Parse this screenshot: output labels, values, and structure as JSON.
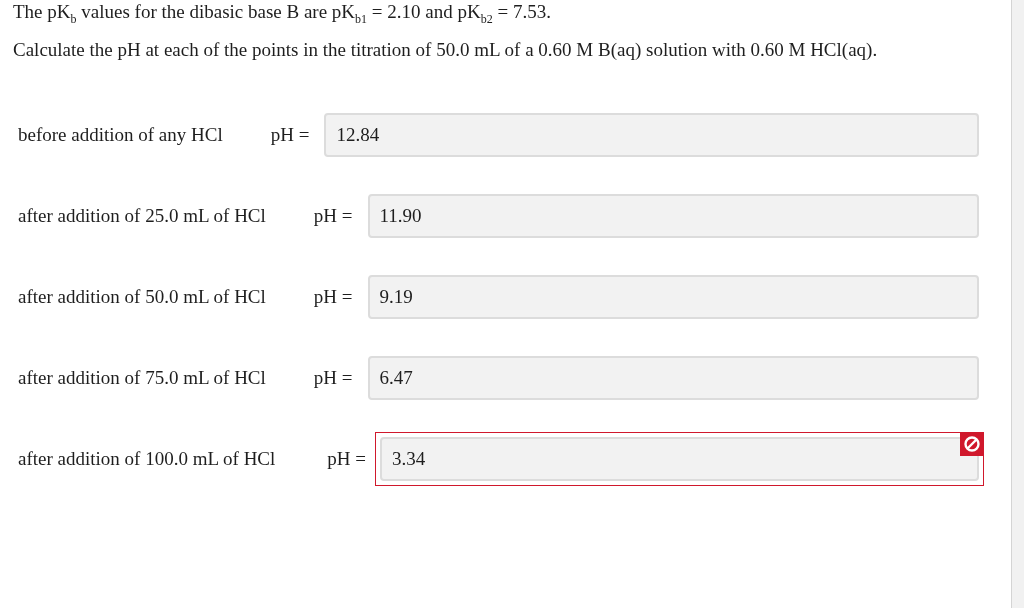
{
  "question": {
    "intro": "The pK$_{b}$ values for the dibasic base B are pK$_{b1}$ = 2.10 and pK$_{b2}$ = 7.53.",
    "instruction": "Calculate the pH at each of the points in the titration of 50.0 mL of a 0.60 M B(aq) solution with 0.60 M HCl(aq)."
  },
  "answers": [
    {
      "label": "before addition of any HCl",
      "prefix": "pH =",
      "value": "12.84",
      "incorrect": false
    },
    {
      "label": "after addition of 25.0 mL of HCl",
      "prefix": "pH =",
      "value": "11.90",
      "incorrect": false
    },
    {
      "label": "after addition of 50.0 mL of HCl",
      "prefix": "pH =",
      "value": "9.19",
      "incorrect": false
    },
    {
      "label": "after addition of 75.0 mL of HCl",
      "prefix": "pH =",
      "value": "6.47",
      "incorrect": false
    },
    {
      "label": "after addition of 100.0 mL of HCl",
      "prefix": "pH =",
      "value": "3.34",
      "incorrect": true
    }
  ]
}
